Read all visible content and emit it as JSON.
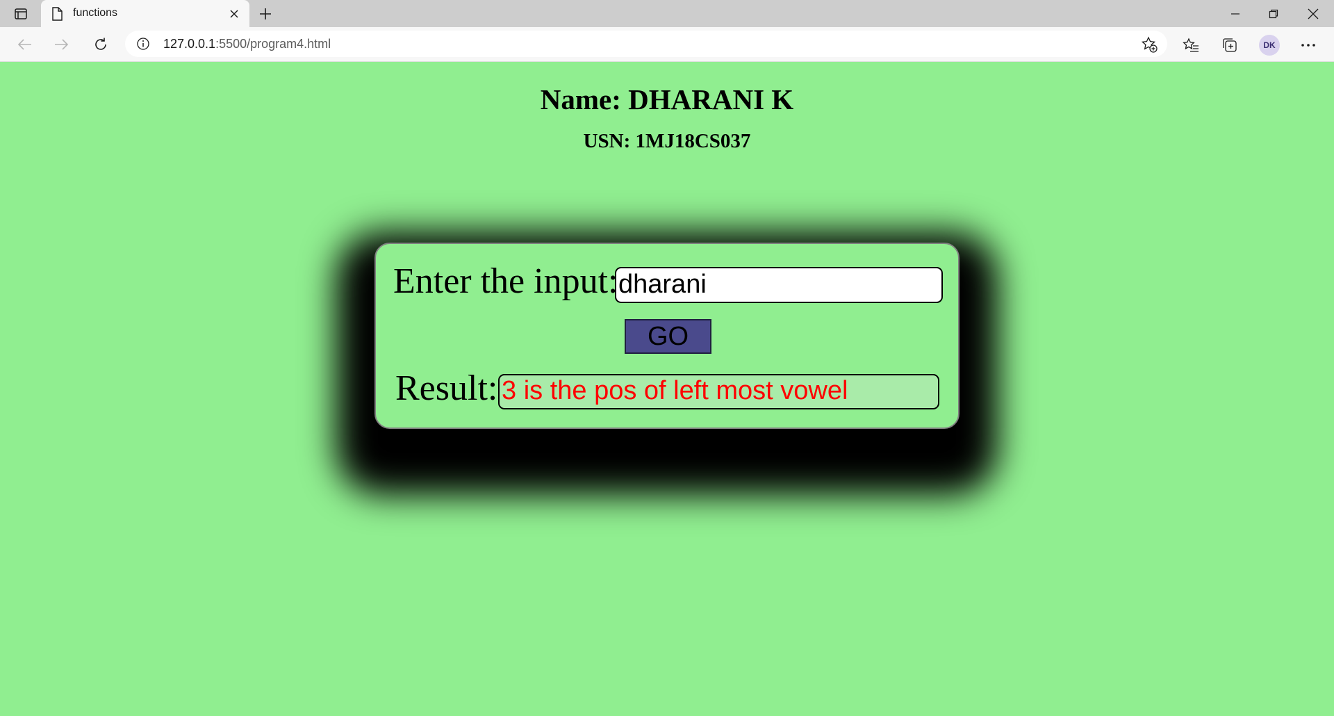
{
  "browser": {
    "tab_title": "functions",
    "url_host": "127.0.0.1",
    "url_path": ":5500/program4.html",
    "profile_initials": "DK",
    "icons": [
      "sidebar-icon",
      "page-icon",
      "close-icon",
      "plus-icon",
      "minimize-icon",
      "restore-icon",
      "back-icon",
      "forward-icon",
      "reload-icon",
      "info-icon",
      "add-favorite-icon",
      "favorites-icon",
      "collections-icon",
      "more-icon"
    ]
  },
  "page": {
    "name_heading": "Name: DHARANI K",
    "usn_heading": "USN: 1MJ18CS037",
    "input_label": "Enter the input:",
    "input_value": "dharani",
    "go_label": "GO",
    "result_label": "Result:",
    "result_value": "3 is the pos of left most vowel"
  },
  "colors": {
    "background": "#90ee90",
    "button": "#4a4a8c",
    "result_text": "#ff0000",
    "result_field": "#a9eba9",
    "card_shadow": "#000000"
  }
}
